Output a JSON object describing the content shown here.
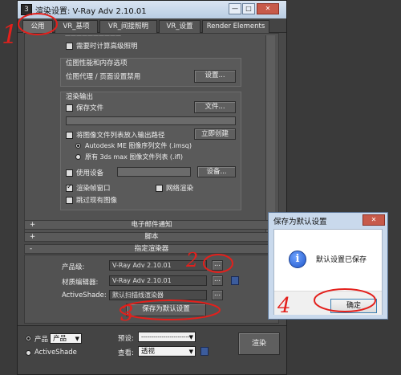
{
  "window": {
    "title": "渲染设置: V-Ray Adv 2.10.01",
    "app_icon": "3ds-max-icon",
    "controls": {
      "minimize": "—",
      "maximize": "□",
      "close": "✕"
    }
  },
  "tabs": [
    {
      "label": "公用",
      "active": true
    },
    {
      "label": "VR_基项",
      "active": false
    },
    {
      "label": "VR_间接照明",
      "active": false
    },
    {
      "label": "VR_设置",
      "active": false
    },
    {
      "label": "Render Elements",
      "active": false
    }
  ],
  "common": {
    "cut_top_label": "——————————",
    "require_advanced_lighting": "需要时计算高级照明",
    "bitmap_group": {
      "title": "位图性能和内存选项",
      "text": "位图代理 / 页面设置禁用",
      "settings_button": "设置..."
    },
    "render_output": {
      "title": "渲染输出",
      "save_file": "保存文件",
      "files_button": "文件...",
      "put_list": "将图像文件列表放入输出路径",
      "create_now_button": "立即创建",
      "radio_imsq": "Autodesk ME 图像序列文件 (.imsq)",
      "radio_ifl": "原有 3ds max 图像文件列表 (.ifl)",
      "use_device": "使用设备",
      "devices_button": "设备...",
      "render_frame_window": "渲染帧窗口",
      "net_render": "网络渲染",
      "skip_existing": "跳过现有图像"
    }
  },
  "rollouts": [
    {
      "sign": "+",
      "title": "电子邮件通知"
    },
    {
      "sign": "+",
      "title": "脚本"
    },
    {
      "sign": "-",
      "title": "指定渲染器"
    }
  ],
  "assign_renderer": {
    "production_label": "产品级:",
    "production_value": "V-Ray Adv 2.10.01",
    "material_editor_label": "材质编辑器:",
    "material_editor_value": "V-Ray Adv 2.10.01",
    "activeshade_label": "ActiveShade:",
    "activeshade_value": "默认扫描线渲染器",
    "browse_label": "...",
    "save_default_button": "保存为默认设置"
  },
  "bottom_bar": {
    "product_radio": "产品",
    "product_select": "产品",
    "activeshade_radio": "ActiveShade",
    "preset_label": "预设:",
    "preset_value": "------------------------",
    "view_label": "查看:",
    "view_value": "透视",
    "render_button": "渲染"
  },
  "dialog": {
    "title": "保存为默认设置",
    "message": "默认设置已保存",
    "ok_button": "确定",
    "icon": "info-icon",
    "close": "✕"
  },
  "annotations": {
    "a1": "1",
    "a2": "2",
    "a3": "3",
    "a4": "4"
  },
  "colors": {
    "annotation_red": "#e3201c",
    "title_bar": "#c9d9ec",
    "panel": "#525252"
  }
}
